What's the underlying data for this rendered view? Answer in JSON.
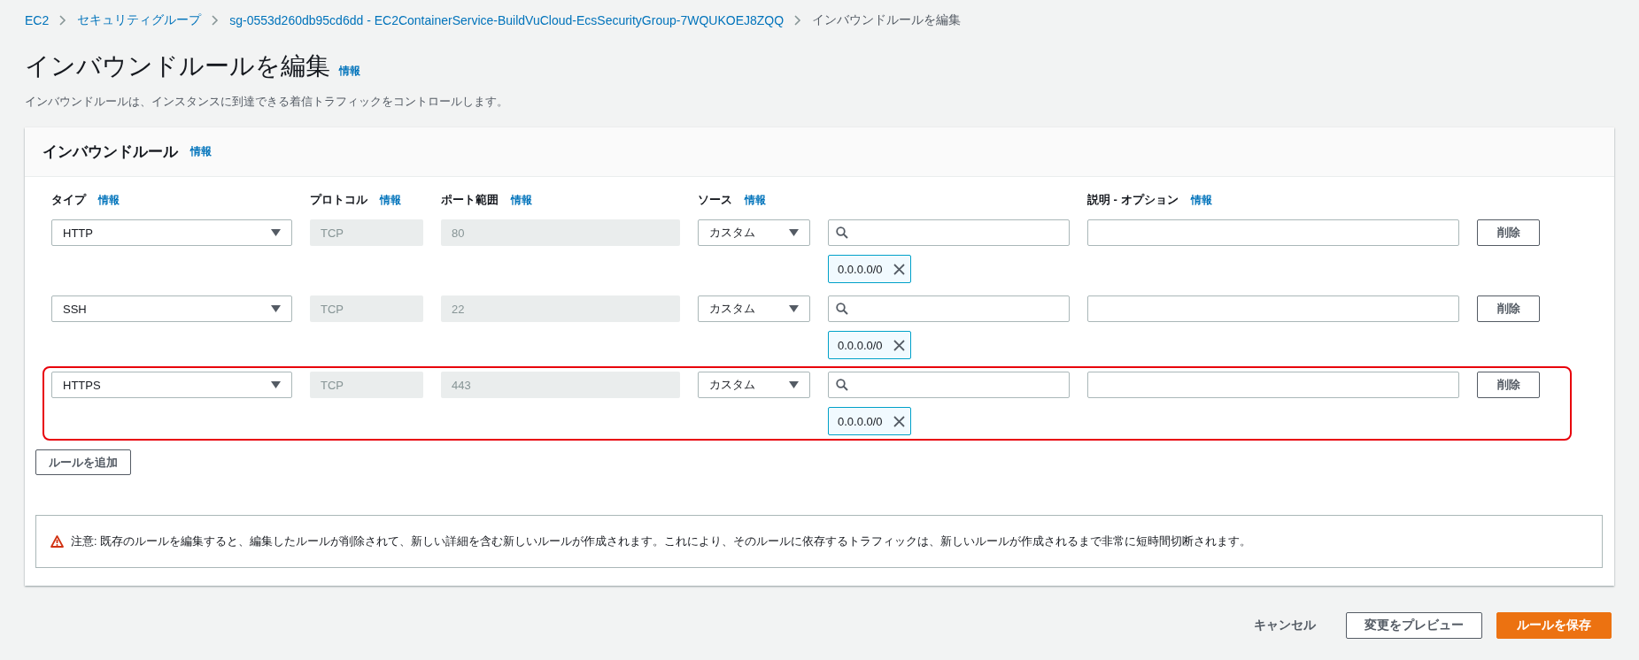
{
  "breadcrumb": [
    {
      "label": "EC2",
      "link": true
    },
    {
      "label": "セキュリティグループ",
      "link": true
    },
    {
      "label": "sg-0553d260db95cd6dd - EC2ContainerService-BuildVuCloud-EcsSecurityGroup-7WQUKOEJ8ZQQ",
      "link": true
    },
    {
      "label": "インバウンドルールを編集",
      "link": false
    }
  ],
  "page": {
    "title": "インバウンドルールを編集",
    "info": "情報",
    "description": "インバウンドルールは、インスタンスに到達できる着信トラフィックをコントロールします。"
  },
  "panel": {
    "title": "インバウンドルール",
    "info": "情報",
    "columns": [
      {
        "label": "タイプ",
        "info": "情報"
      },
      {
        "label": "プロトコル",
        "info": "情報"
      },
      {
        "label": "ポート範囲",
        "info": "情報"
      },
      {
        "label": "ソース",
        "info": "情報"
      },
      {
        "label": "説明 - オプション",
        "info": "情報"
      }
    ],
    "rules": [
      {
        "type": "HTTP",
        "protocol": "TCP",
        "port": "80",
        "source": "カスタム",
        "cidr": "0.0.0.0/0",
        "delete": "削除",
        "highlighted": false
      },
      {
        "type": "SSH",
        "protocol": "TCP",
        "port": "22",
        "source": "カスタム",
        "cidr": "0.0.0.0/0",
        "delete": "削除",
        "highlighted": false
      },
      {
        "type": "HTTPS",
        "protocol": "TCP",
        "port": "443",
        "source": "カスタム",
        "cidr": "0.0.0.0/0",
        "delete": "削除",
        "highlighted": true
      }
    ],
    "add_button": "ルールを追加",
    "warning": "注意: 既存のルールを編集すると、編集したルールが削除されて、新しい詳細を含む新しいルールが作成されます。これにより、そのルールに依存するトラフィックは、新しいルールが作成されるまで非常に短時間切断されます。"
  },
  "footer": {
    "cancel": "キャンセル",
    "preview": "変更をプレビュー",
    "save": "ルールを保存"
  }
}
